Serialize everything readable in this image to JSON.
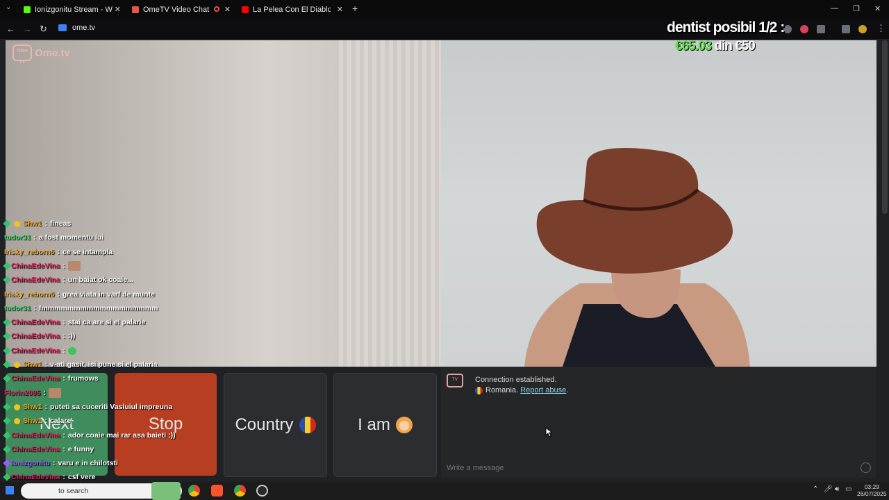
{
  "browser": {
    "tabs": [
      {
        "title": "Ionizgonitu Stream - Watch Liv",
        "favicon": "kick-icon",
        "color": "#53fc18"
      },
      {
        "title": "OmeTV Video Chat — Ome",
        "favicon": "ometv-icon",
        "color": "#e4564a"
      },
      {
        "title": "La Pelea Con El Diablo - YouTub",
        "favicon": "youtube-icon",
        "color": "#ff0000"
      }
    ],
    "new_tab": "+",
    "url": "ome.tv"
  },
  "stream_overlay": {
    "title": "dentist posibil 1/2 :",
    "amount": "€65.03",
    "goal": "din €50"
  },
  "app": {
    "logo_text": "Ome.tv",
    "logo_badge": "Ome TV",
    "buttons": {
      "next": "Next",
      "stop": "Stop",
      "country": "Country",
      "iam": "I am"
    },
    "chat": {
      "status": "Connection established.",
      "country": "Romania.",
      "report": "Report abuse",
      "report_suffix": ".",
      "placeholder": "Write a message"
    }
  },
  "stream_chat": [
    {
      "user": "Shw1",
      "color": "#f5a623",
      "badges": [
        "diamond",
        "coin"
      ],
      "text": "fineas"
    },
    {
      "user": "tudor31",
      "color": "#3ee06b",
      "badges": [],
      "text": "a fost momentu lui"
    },
    {
      "user": "Irisky_reborn6",
      "color": "#f6b73c",
      "badges": [],
      "text": "ce se intampla"
    },
    {
      "user": "ChinaEdeVina",
      "color": "#e0245e",
      "badges": [
        "diamond"
      ],
      "text": "",
      "emote": "face-emote"
    },
    {
      "user": "ChinaEdeVina",
      "color": "#e0245e",
      "badges": [
        "diamond"
      ],
      "text": "un baiat ok coaie..."
    },
    {
      "user": "Irisky_reborn6",
      "color": "#f6b73c",
      "badges": [],
      "text": "grea viata in varf de munte"
    },
    {
      "user": "tudor31",
      "color": "#3ee06b",
      "badges": [],
      "text": "fmmmmmmmmmmmmmmmmmm"
    },
    {
      "user": "ChinaEdeVina",
      "color": "#e0245e",
      "badges": [
        "diamond"
      ],
      "text": "stai ca are si el palarie"
    },
    {
      "user": "ChinaEdeVina",
      "color": "#e0245e",
      "badges": [
        "diamond"
      ],
      "text": ":))"
    },
    {
      "user": "ChinaEdeVina",
      "color": "#e0245e",
      "badges": [
        "diamond"
      ],
      "text": "",
      "emote": "heart-emote"
    },
    {
      "user": "Shw1",
      "color": "#f5a623",
      "badges": [
        "diamond",
        "coin"
      ],
      "text": "v-ati gasit, isi pune si el palaria"
    },
    {
      "user": "ChinaEdeVina",
      "color": "#e0245e",
      "badges": [
        "diamond"
      ],
      "text": "frumows"
    },
    {
      "user": "Florin2095",
      "color": "#e0245e",
      "badges": [],
      "text": "",
      "emote": "face-emote"
    },
    {
      "user": "Shw1",
      "color": "#f5a623",
      "badges": [
        "diamond",
        "coin"
      ],
      "text": "puteti sa cuceriti Vasluiul impreuna"
    },
    {
      "user": "Shw1",
      "color": "#f5a623",
      "badges": [
        "diamond",
        "coin"
      ],
      "text": "calare"
    },
    {
      "user": "ChinaEdeVina",
      "color": "#e0245e",
      "badges": [
        "diamond"
      ],
      "text": "ador coaie mai rar asa baieti :))"
    },
    {
      "user": "ChinaEdeVina",
      "color": "#e0245e",
      "badges": [
        "diamond"
      ],
      "text": "e funny"
    },
    {
      "user": "Ionizgonitu",
      "color": "#9b59ff",
      "badges": [
        "diamond-purple"
      ],
      "text": "varu e in chilotsti"
    },
    {
      "user": "ChinaEdeVina",
      "color": "#e0245e",
      "badges": [
        "diamond"
      ],
      "text": "csf vere"
    },
    {
      "user": "ChinaEdeVina",
      "color": "#e0245e",
      "badges": [
        "diamond"
      ],
      "text": "))"
    }
  ],
  "taskbar": {
    "search_placeholder": "to search",
    "time": "03:29",
    "date": "26/07/2025"
  }
}
